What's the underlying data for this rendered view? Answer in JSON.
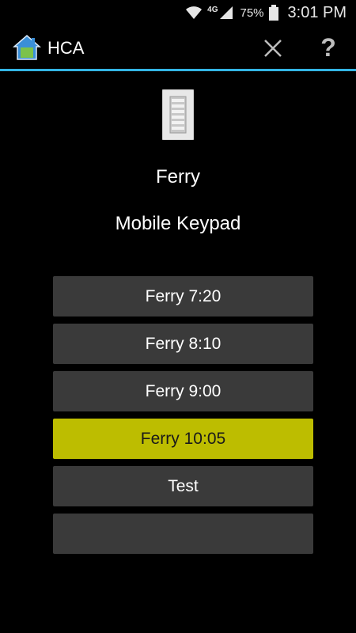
{
  "status_bar": {
    "network_type": "4G",
    "battery_percent": "75%",
    "time": "3:01 PM"
  },
  "action_bar": {
    "title": "HCA",
    "logo_icon": "hca-house-icon",
    "close_icon": "close-icon",
    "help_label": "?"
  },
  "device": {
    "image_icon": "keypad-icon",
    "name": "Ferry",
    "type": "Mobile Keypad"
  },
  "buttons": [
    {
      "label": "Ferry 7:20",
      "active": false
    },
    {
      "label": "Ferry 8:10",
      "active": false
    },
    {
      "label": "Ferry 9:00",
      "active": false
    },
    {
      "label": "Ferry 10:05",
      "active": true
    },
    {
      "label": "Test",
      "active": false
    },
    {
      "label": "",
      "active": false
    }
  ],
  "colors": {
    "accent": "#33b5e5",
    "active_button": "#bdbd00",
    "button": "#3a3a3a"
  }
}
